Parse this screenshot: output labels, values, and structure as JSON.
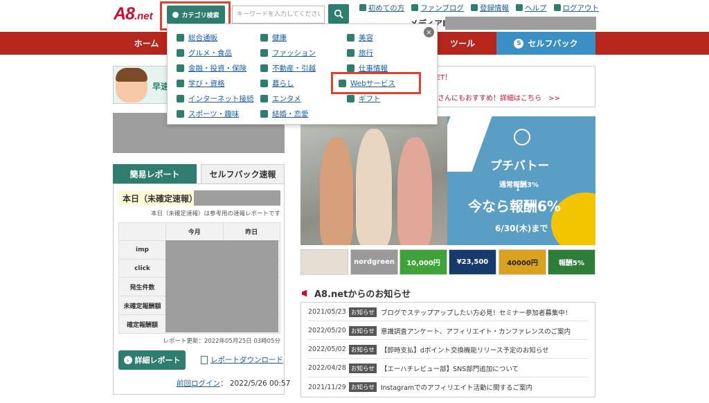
{
  "header": {
    "logo_main": "A8",
    "logo_suffix": ".net",
    "category_button": "カテゴリ検索",
    "search_placeholder": "キーワードを入力してください",
    "top_links": [
      "初めての方",
      "ファンブログ",
      "登録情報",
      "ヘルプ",
      "ログアウト"
    ],
    "media_id_label": "メディアID："
  },
  "nav": {
    "items": [
      "ホーム",
      "ツール"
    ],
    "selfback": "セルフバック",
    "selfback_icon": "S"
  },
  "dropdown": {
    "close": "×",
    "categories": [
      [
        "総合通販",
        "健康",
        "美容"
      ],
      [
        "グルメ・食品",
        "ファッション",
        "旅行"
      ],
      [
        "金融・投資・保険",
        "不動産・引越",
        "仕事情報"
      ],
      [
        "学び・資格",
        "暮らし",
        "Webサービス"
      ],
      [
        "インターネット接続",
        "エンタメ",
        "ギフト"
      ],
      [
        "スポーツ・趣味",
        "結婚・恋愛"
      ]
    ]
  },
  "left": {
    "banner_text": "早速",
    "tabs": [
      "簡易レポート",
      "セルフバック速報"
    ],
    "today_label": "本日（未確定速報）",
    "today_note": "本日（未確定速報）は参考用の速報レポートです",
    "table": {
      "columns": [
        "今月",
        "昨日"
      ],
      "rows": [
        "imp",
        "click",
        "発生件数",
        "未確定報酬額",
        "確定報酬額"
      ]
    },
    "update_text": "レポート更新：2022年05月25日 03時05分",
    "detail_button": "詳細レポート",
    "download_link": "レポートダウンロード",
    "last_login_label": "前回ログイン",
    "last_login_sep": "：",
    "last_login_value": "2022/5/26 00:57"
  },
  "right": {
    "promo1": "GET！",
    "promo2": "アさんにもおすすめ！詳細はこちら　>>",
    "hero": {
      "title": "プチバトー",
      "line1": "通常報酬3%",
      "arrow": "↓",
      "line2": "今なら報酬6%",
      "date": "6/30(木)まで"
    },
    "thumbs": [
      "",
      "nordgreen",
      "10,000円",
      "¥23,500",
      "40000円",
      "報酬5%"
    ],
    "news_title": "A8.netからのお知らせ",
    "news": [
      {
        "date": "2021/05/23",
        "badge": "お知らせ",
        "title": "ブログでステップアップしたい方必見！セミナー参加者募集中！"
      },
      {
        "date": "2022/05/20",
        "badge": "お知らせ",
        "title": "意識調査アンケート、アフィリエイト・カンファレンスのご案内"
      },
      {
        "date": "2022/05/02",
        "badge": "お知らせ",
        "title": "【即時支払】dポイント交換機能リリース予定のお知らせ"
      },
      {
        "date": "2022/04/28",
        "badge": "お知らせ",
        "title": "【エーハチレビュー部】SNS部門追加について"
      },
      {
        "date": "2021/11/29",
        "badge": "お知らせ",
        "title": "Instagramでのアフィリエイト活動に関するご案内"
      }
    ]
  },
  "colors": {
    "brand_red": "#b5261c",
    "brand_green": "#2e7d6e",
    "selfback_blue": "#3a8fc4",
    "highlight": "#e2402a",
    "link": "#1a5ea8"
  }
}
